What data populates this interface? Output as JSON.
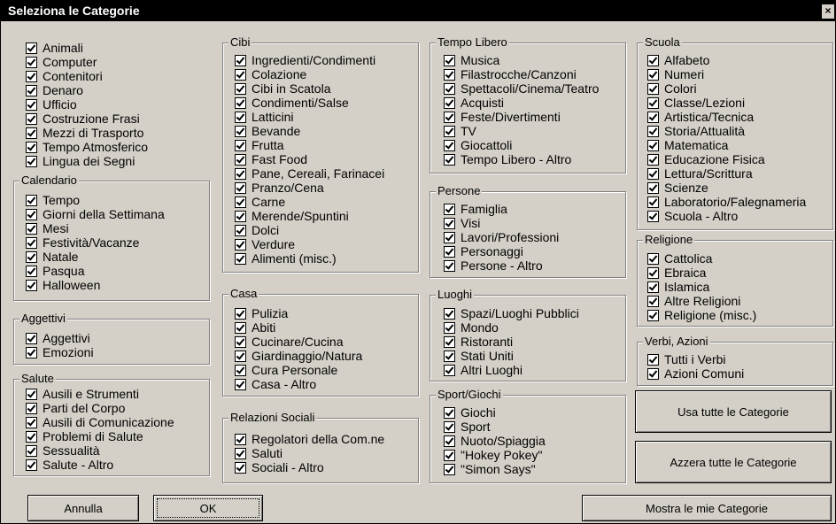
{
  "window": {
    "title": "Seleziona le Categorie",
    "close": "×"
  },
  "col1": [
    {
      "title": "",
      "items": [
        "Animali",
        "Computer",
        "Contenitori",
        "Denaro",
        "Ufficio",
        "Costruzione Frasi",
        "Mezzi di Trasporto",
        "Tempo Atmosferico",
        "Lingua dei Segni"
      ]
    },
    {
      "title": "Calendario",
      "items": [
        "Tempo",
        "Giorni della Settimana",
        "Mesi",
        "Festività/Vacanze",
        "Natale",
        "Pasqua",
        "Halloween"
      ]
    },
    {
      "title": "Aggettivi",
      "items": [
        "Aggettivi",
        "Emozioni"
      ]
    },
    {
      "title": "Salute",
      "items": [
        "Ausili e Strumenti",
        "Parti del Corpo",
        "Ausili di Comunicazione",
        "Problemi di Salute",
        "Sessualità",
        "Salute - Altro"
      ]
    }
  ],
  "col2": [
    {
      "title": "Cibi",
      "items": [
        "Ingredienti/Condimenti",
        "Colazione",
        "Cibi in Scatola",
        "Condimenti/Salse",
        "Latticini",
        "Bevande",
        "Frutta",
        "Fast Food",
        "Pane, Cereali, Farinacei",
        "Pranzo/Cena",
        "Carne",
        "Merende/Spuntini",
        "Dolci",
        "Verdure",
        "Alimenti (misc.)"
      ]
    },
    {
      "title": "Casa",
      "items": [
        "Pulizia",
        "Abiti",
        "Cucinare/Cucina",
        "Giardinaggio/Natura",
        "Cura Personale",
        "Casa - Altro"
      ]
    },
    {
      "title": "Relazioni Sociali",
      "items": [
        "Regolatori della Com.ne",
        "Saluti",
        "Sociali - Altro"
      ]
    }
  ],
  "col3": [
    {
      "title": "Tempo Libero",
      "items": [
        "Musica",
        "Filastrocche/Canzoni",
        "Spettacoli/Cinema/Teatro",
        "Acquisti",
        "Feste/Divertimenti",
        "TV",
        "Giocattoli",
        "Tempo Libero - Altro"
      ]
    },
    {
      "title": "Persone",
      "items": [
        "Famiglia",
        "Visi",
        "Lavori/Professioni",
        "Personaggi",
        "Persone - Altro"
      ]
    },
    {
      "title": "Luoghi",
      "items": [
        "Spazi/Luoghi Pubblici",
        "Mondo",
        "Ristoranti",
        "Stati Uniti",
        "Altri Luoghi"
      ]
    },
    {
      "title": "Sport/Giochi",
      "items": [
        "Giochi",
        "Sport",
        "Nuoto/Spiaggia",
        "\"Hokey Pokey\"",
        "\"Simon Says\""
      ]
    }
  ],
  "col4": [
    {
      "title": "Scuola",
      "items": [
        "Alfabeto",
        "Numeri",
        "Colori",
        "Classe/Lezioni",
        "Artistica/Tecnica",
        "Storia/Attualità",
        "Matematica",
        "Educazione Fisica",
        "Lettura/Scrittura",
        "Scienze",
        "Laboratorio/Falegnameria",
        "Scuola - Altro"
      ]
    },
    {
      "title": "Religione",
      "items": [
        "Cattolica",
        "Ebraica",
        "Islamica",
        "Altre Religioni",
        "Religione (misc.)"
      ]
    },
    {
      "title": "Verbi, Azioni",
      "items": [
        "Tutti i Verbi",
        "Azioni Comuni"
      ]
    }
  ],
  "buttons": {
    "use_all": "Usa tutte le Categorie",
    "reset_all": "Azzera tutte le Categorie",
    "cancel": "Annulla",
    "ok": "OK",
    "show_mine": "Mostra le mie Categorie"
  }
}
